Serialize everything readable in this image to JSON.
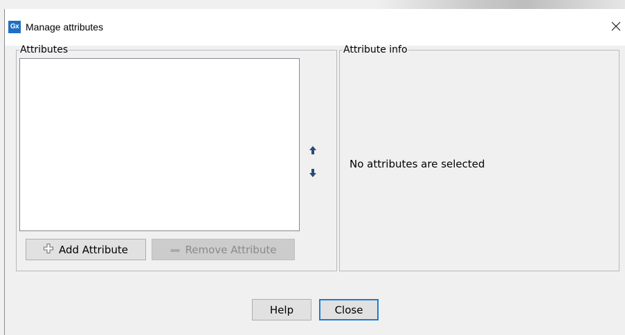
{
  "window": {
    "app_icon_text": "Gx",
    "title": "Manage attributes",
    "close_glyph": "✕"
  },
  "attributes_panel": {
    "legend": "Attributes",
    "items": [],
    "add_label": "Add Attribute",
    "remove_label": "Remove Attribute",
    "move_up_icon": "arrow-up-icon",
    "move_down_icon": "arrow-down-icon"
  },
  "info_panel": {
    "legend": "Attribute info",
    "empty_message": "No attributes are selected"
  },
  "footer": {
    "help_label": "Help",
    "close_label": "Close"
  },
  "colors": {
    "accent": "#1a7bd6",
    "app_icon": "#1f6fc5",
    "arrow": "#2a4a7a"
  }
}
